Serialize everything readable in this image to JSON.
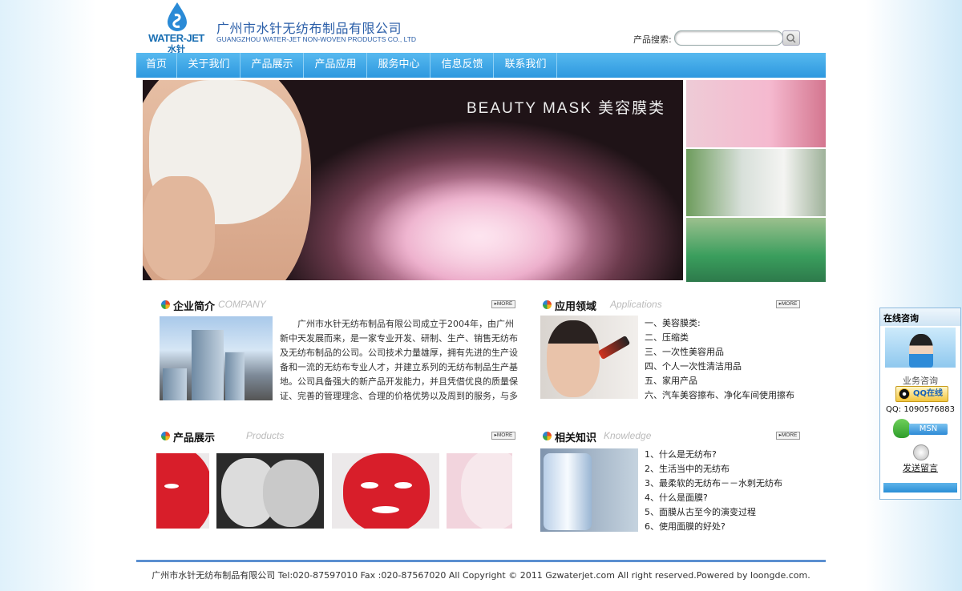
{
  "header": {
    "logo_en": "WATER-JET",
    "logo_cn": "水针",
    "company_cn": "广州市水针无纺布制品有限公司",
    "company_en": "GUANGZHOU WATER-JET NON-WOVEN PRODUCTS CO., LTD"
  },
  "search": {
    "label": "产品搜索:",
    "value": "",
    "button_icon": "search-icon"
  },
  "nav": {
    "items": [
      "首页",
      "关于我们",
      "产品展示",
      "产品应用",
      "服务中心",
      "信息反馈",
      "联系我们"
    ]
  },
  "banner": {
    "title": "BEAUTY  MASK  美容膜类"
  },
  "sections": {
    "company": {
      "title_cn": "企业简介",
      "title_en": "COMPANY",
      "more": "▸MORE",
      "text": "广州市水针无纺布制品有限公司成立于2004年，由广州新中天发展而来，是一家专业开发、研制、生产、销售无纺布及无纺布制品的公司。公司技术力量雄厚，拥有先进的生产设备和一流的无纺布专业人才，并建立系列的无纺布制品生产基地。公司具备强大的新产品开发能力，并且凭借优良的质量保证、完善的管理理念、合理的价格优势以及周到的服务，与多家国内大型"
    },
    "applications": {
      "title_cn": "应用领域",
      "title_en": "Applications",
      "more": "▸MORE",
      "items": [
        "一、美容膜类:",
        "二、压缩类",
        "三、一次性美容用品",
        "四、个人一次性清洁用品",
        "五、家用产品",
        "六、汽车美容擦布、净化车间使用擦布"
      ]
    },
    "products": {
      "title_cn": "产品展示",
      "title_en": "Products",
      "more": "▸MORE"
    },
    "knowledge": {
      "title_cn": "相关知识",
      "title_en": "Knowledge",
      "more": "▸MORE",
      "items": [
        "1、什么是无纺布?",
        "2、生活当中的无纺布",
        "3、最柔软的无纺布－－水刺无纺布",
        "4、什么是面膜?",
        "5、面膜从古至今的演变过程",
        "6、使用面膜的好处?"
      ]
    }
  },
  "footer": {
    "text": "广州市水针无纺布制品有限公司 Tel:020-87597010 Fax :020-87567020     All Copyright © 2011 Gzwaterjet.com All right reserved.Powered by loongde.com."
  },
  "consult": {
    "title": "在线咨询",
    "business": "业务咨询",
    "qq_button": "QQ在线",
    "qq_number": "QQ: 1090576883",
    "msn": "MSN",
    "message": "发送留言"
  },
  "colors": {
    "nav_blue": "#2d98df",
    "brand_blue": "#2a5ea8",
    "footer_line": "#5b8fd0"
  }
}
